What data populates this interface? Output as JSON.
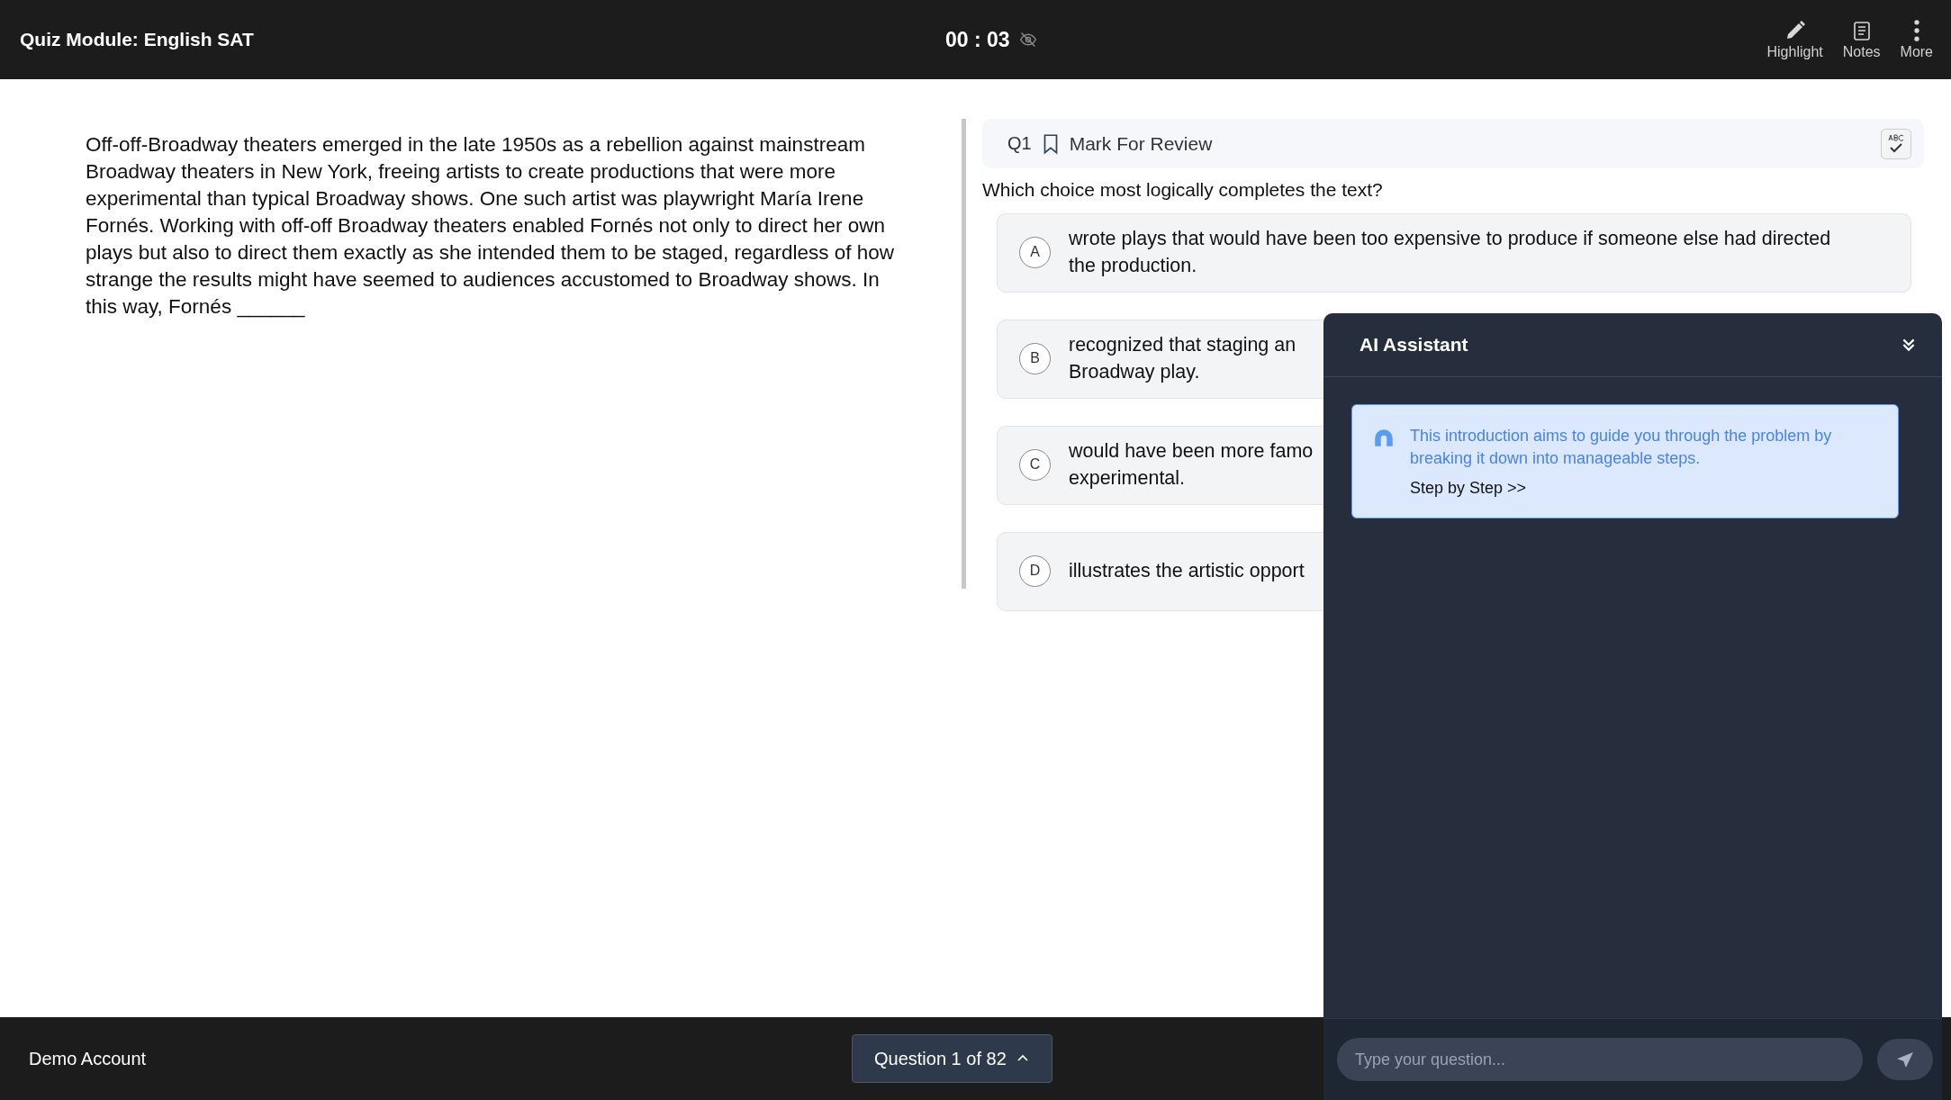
{
  "header": {
    "title": "Quiz Module: English SAT",
    "timer": "00 : 03",
    "tools": [
      {
        "label": "Highlight"
      },
      {
        "label": "Notes"
      },
      {
        "label": "More"
      }
    ]
  },
  "passage": "Off-off-Broadway theaters emerged in the late 1950s as a rebellion against mainstream Broadway theaters in New York, freeing artists to create productions that were more experimental than typical Broadway shows. One such artist was playwright María Irene Fornés. Working with off-off Broadway theaters enabled Fornés not only to direct her own plays but also to direct them exactly as she intended them to be staged, regardless of how strange the results might have seemed to audiences accustomed to Broadway shows. In this way, Fornés ______",
  "question": {
    "number": "Q1",
    "mark_label": "Mark For Review",
    "marked": false,
    "prompt": "Which choice most logically completes the text?",
    "choices": [
      {
        "letter": "A",
        "lines": [
          "wrote plays that would have been too expensive to produce if someone else had directed",
          "the production."
        ],
        "selected": false
      },
      {
        "letter": "B",
        "lines": [
          "recognized that staging an",
          "Broadway play."
        ],
        "selected": false
      },
      {
        "letter": "C",
        "lines": [
          "would have been more famo",
          "experimental."
        ],
        "selected": false
      },
      {
        "letter": "D",
        "lines": [
          "illustrates the artistic opport"
        ],
        "selected": false
      }
    ]
  },
  "assistant": {
    "title": "AI Assistant",
    "message": "This introduction aims to guide you through the problem by breaking it down into manageable steps.",
    "link": "Step by Step >>",
    "input": {
      "placeholder": "Type your question..."
    }
  },
  "footer": {
    "account": "Demo Account",
    "navigator": "Question 1 of 82"
  }
}
